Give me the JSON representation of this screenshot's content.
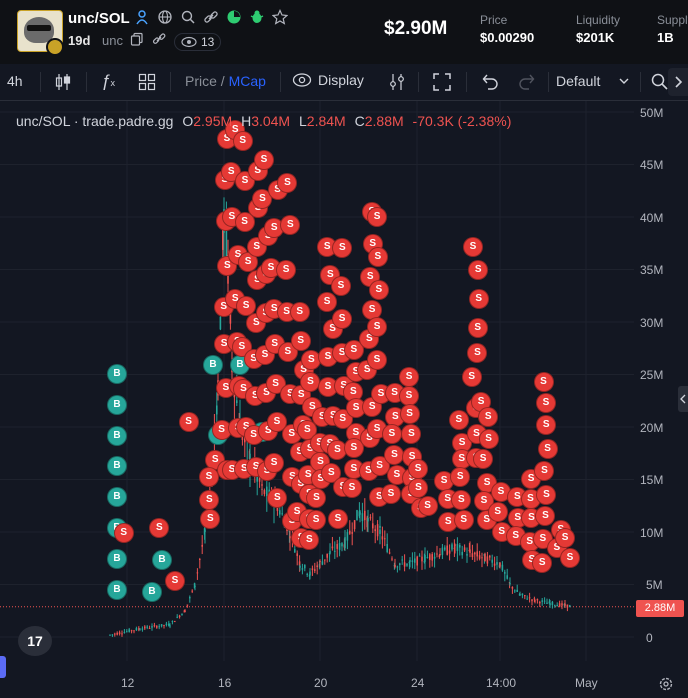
{
  "header": {
    "token_name": "unc/SOL",
    "age": "19d",
    "ticker": "unc",
    "views": "13",
    "market_cap": "$2.90M",
    "stats": [
      {
        "label": "Price",
        "value": "$0.00290"
      },
      {
        "label": "Liquidity",
        "value": "$201K"
      },
      {
        "label": "Supply",
        "value": "1B"
      }
    ],
    "icons": [
      "user-icon",
      "globe-icon",
      "search-icon",
      "link-icon",
      "chart-icon",
      "bug-icon",
      "star-icon"
    ]
  },
  "toolbar": {
    "interval": "4h",
    "price_label": "Price",
    "separator": "/",
    "mcap_label": "MCap",
    "display_label": "Display",
    "layout_label": "Default"
  },
  "legend": {
    "symbol": "unc/SOL · trade.padre.gg",
    "o_key": "O",
    "o_val": "2.95M",
    "h_key": "H",
    "h_val": "3.04M",
    "l_key": "L",
    "l_val": "2.84M",
    "c_key": "C",
    "c_val": "2.88M",
    "change": "-70.3K (-2.38%)"
  },
  "chart_data": {
    "type": "candlestick",
    "y_unit": "market cap (USD)",
    "y_ticks": [
      "50M",
      "45M",
      "40M",
      "35M",
      "30M",
      "25M",
      "20M",
      "15M",
      "10M",
      "5M",
      "0"
    ],
    "x_ticks": [
      "12",
      "16",
      "20",
      "24",
      "14:00",
      "May"
    ],
    "last_value": "2.88M",
    "ylim": [
      0,
      50
    ],
    "grid": true,
    "trade_markers": {
      "buy_label": "B",
      "sell_label": "S"
    },
    "colors": {
      "up": "#26a69a",
      "down": "#ef5350",
      "sell_marker": "#e53935",
      "buy_marker": "#26a69a"
    }
  },
  "colors": {
    "background": "#131722",
    "accent": "#2962ff",
    "negative": "#ef5350"
  }
}
